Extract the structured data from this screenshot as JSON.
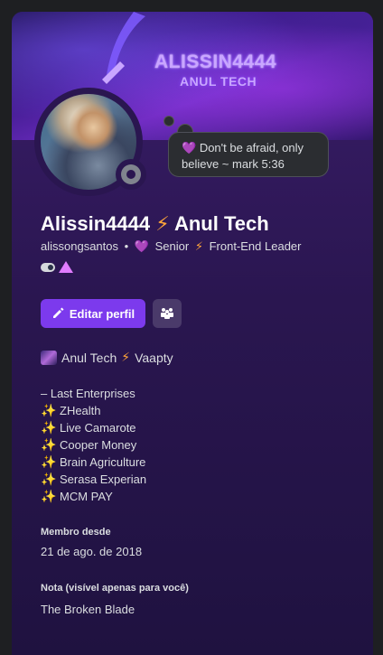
{
  "banner": {
    "title": "ALISSIN4444",
    "subtitle": "ANUL TECH"
  },
  "status_bubble": {
    "icon": "purple-heart",
    "text": "Don't be afraid, only believe ~ mark 5:36"
  },
  "profile": {
    "display_name": "Alissin4444",
    "name_separator_icon": "lightning-bolt",
    "display_suffix": "Anul Tech",
    "username": "alissongsantos",
    "bullet": "•",
    "pronoun_heart": "💜",
    "role": "Senior",
    "role_bolt": "⚡",
    "title": "Front-End Leader",
    "status": "idle"
  },
  "buttons": {
    "edit_label": "Editar perfil",
    "more_icon": "members-icon"
  },
  "bio": {
    "heading_company": "Anul Tech",
    "heading_bolt": "⚡",
    "heading_partner": "Vaapty",
    "subheading": "– Last Enterprises",
    "items": [
      "ZHealth",
      "Live Camarote",
      "Cooper Money",
      "Brain Agriculture",
      "Serasa Experian",
      "MCM PAY"
    ],
    "item_icon": "✨"
  },
  "member_since": {
    "label": "Membro desde",
    "value": "21 de ago. de 2018"
  },
  "note": {
    "label": "Nota (visível apenas para você)",
    "value": "The Broken Blade"
  },
  "colors": {
    "accent": "#7c3aed",
    "bolt": "#ffa53a",
    "background": "#1e1f22"
  }
}
